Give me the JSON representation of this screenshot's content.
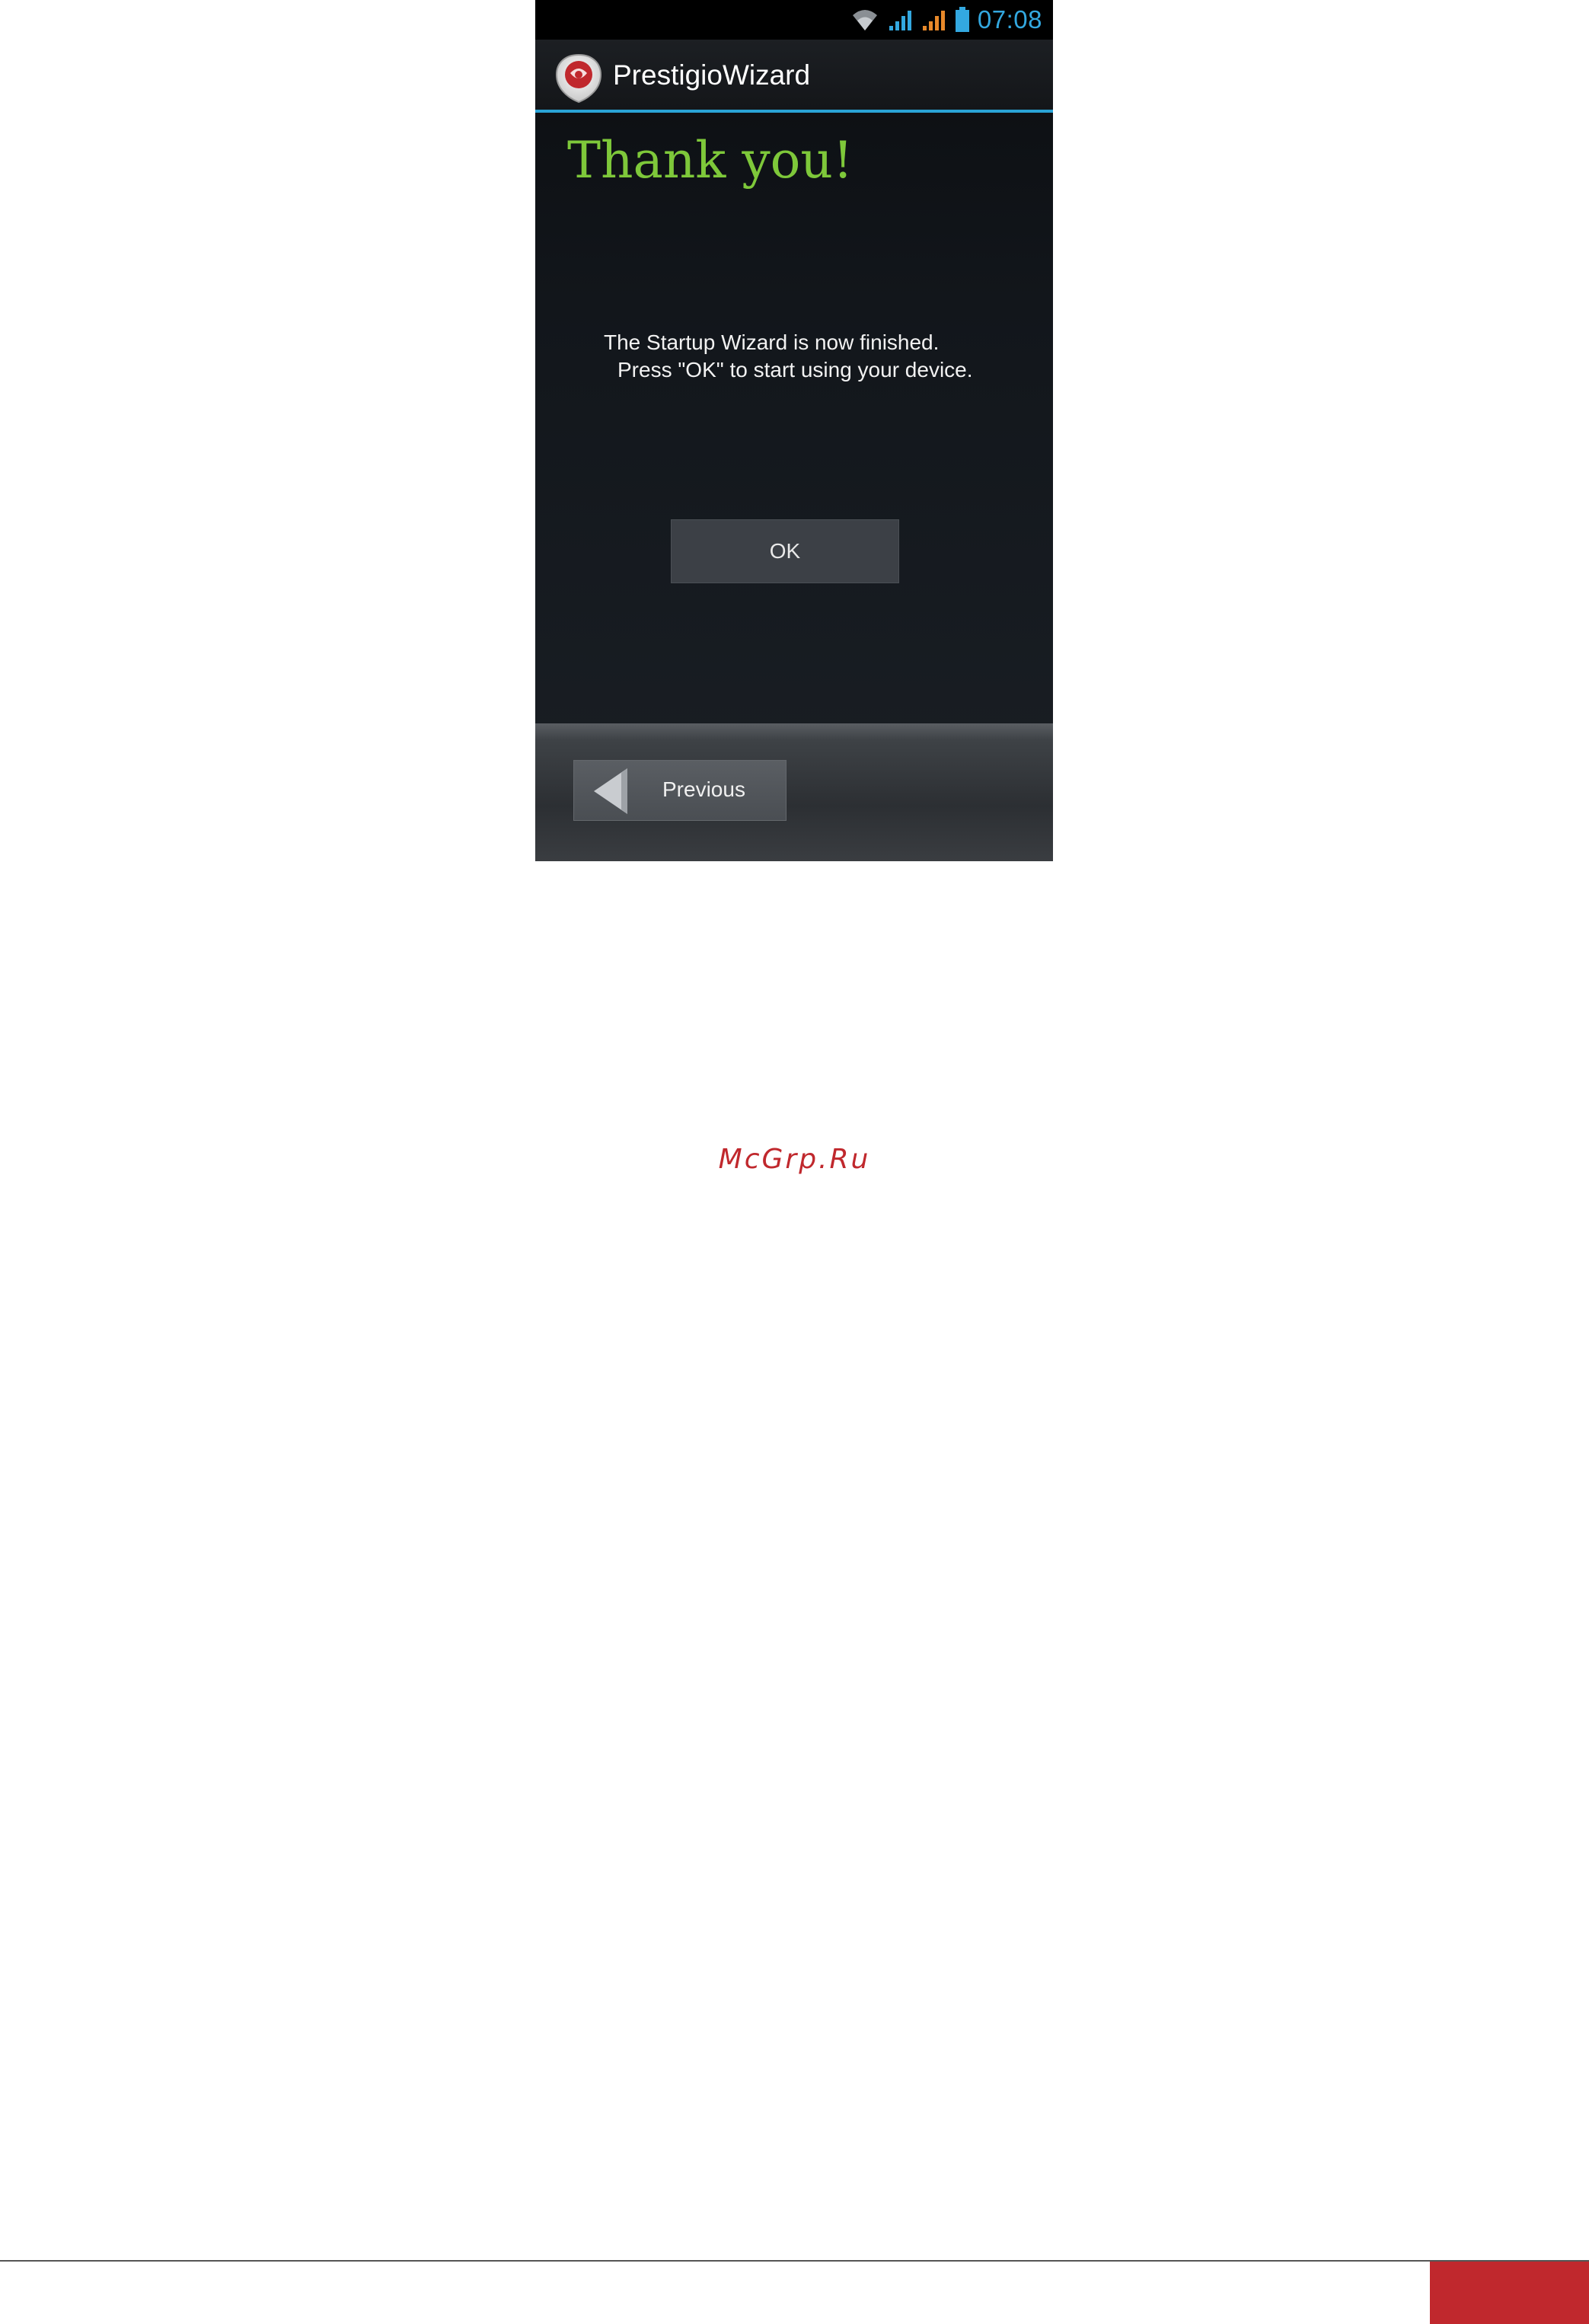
{
  "status_bar": {
    "time": "07:08",
    "icons": [
      "wifi-icon",
      "signal-icon-1",
      "signal-icon-2",
      "battery-icon"
    ],
    "time_color": "#33a8e0"
  },
  "action_bar": {
    "app_icon": "prestigio-logo-icon",
    "title": "PrestigioWizard",
    "accent_color": "#2aa3d6"
  },
  "content": {
    "heading": "Thank you!",
    "heading_color": "#7ec83a",
    "message_line1": "The Startup Wizard is now finished.",
    "message_line2": "Press \"OK\" to start using your device.",
    "ok_label": "OK"
  },
  "bottom_bar": {
    "previous_label": "Previous",
    "previous_icon": "back-arrow-icon"
  },
  "watermark": {
    "text": "McGrp.Ru",
    "color": "#c0282d"
  },
  "footer": {
    "tab_color": "#c0282d"
  }
}
